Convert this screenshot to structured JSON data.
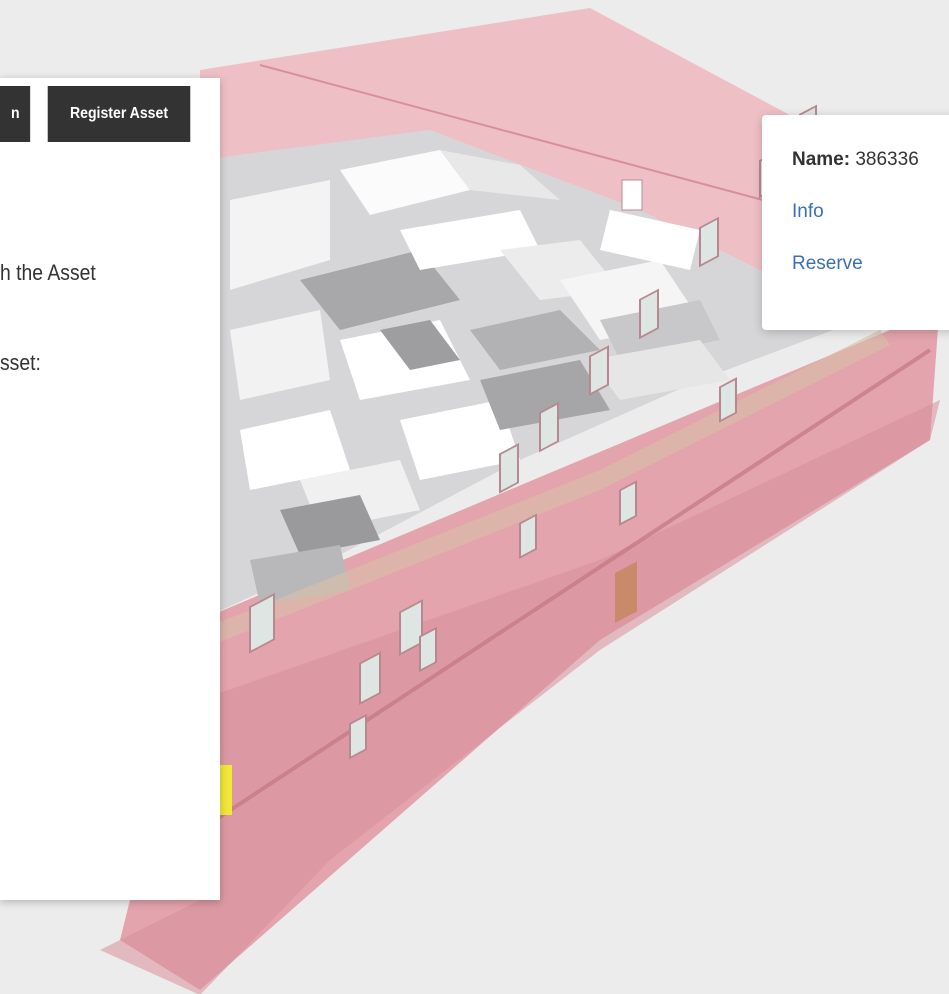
{
  "toolbar": {
    "partial_tab_label": "n",
    "register_asset_label": "Register Asset"
  },
  "panel": {
    "line1": "h the Asset",
    "line2": "sset:"
  },
  "popup": {
    "name_label": "Name:",
    "name_value": "386336",
    "info_link": "Info",
    "reserve_link": "Reserve"
  },
  "colors": {
    "building_wall": "#e8a0aa",
    "button_bg": "#333333",
    "link": "#3a6fb5",
    "highlight": "#f2e83a"
  }
}
